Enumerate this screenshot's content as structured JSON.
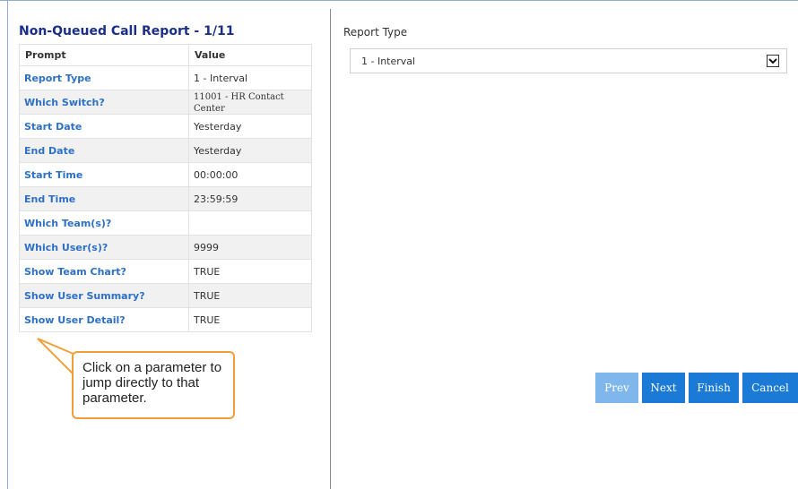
{
  "report": {
    "title": "Non-Queued Call Report - 1/11"
  },
  "params_table": {
    "headers": {
      "prompt": "Prompt",
      "value": "Value"
    },
    "rows": [
      {
        "prompt": "Report Type",
        "value": "1 - Interval"
      },
      {
        "prompt": "Which Switch?",
        "value": "11001 - HR Contact Center"
      },
      {
        "prompt": "Start Date",
        "value": "Yesterday"
      },
      {
        "prompt": "End Date",
        "value": "Yesterday"
      },
      {
        "prompt": "Start Time",
        "value": "00:00:00"
      },
      {
        "prompt": "End Time",
        "value": "23:59:59"
      },
      {
        "prompt": "Which Team(s)?",
        "value": ""
      },
      {
        "prompt": "Which User(s)?",
        "value": "9999"
      },
      {
        "prompt": "Show Team Chart?",
        "value": "TRUE"
      },
      {
        "prompt": "Show User Summary?",
        "value": "TRUE"
      },
      {
        "prompt": "Show User Detail?",
        "value": "TRUE"
      }
    ]
  },
  "callout": {
    "text": "Click on a parameter to jump directly to that parameter."
  },
  "editor": {
    "field_label": "Report Type",
    "select_value": "1 - Interval"
  },
  "buttons": {
    "prev": "Prev",
    "next": "Next",
    "finish": "Finish",
    "cancel": "Cancel"
  },
  "colors": {
    "title": "#1a2f8a",
    "prompt_link": "#2d70c6",
    "button": "#1a7ad6",
    "button_disabled": "#7fb6ec",
    "callout_border": "#f0a03a"
  }
}
